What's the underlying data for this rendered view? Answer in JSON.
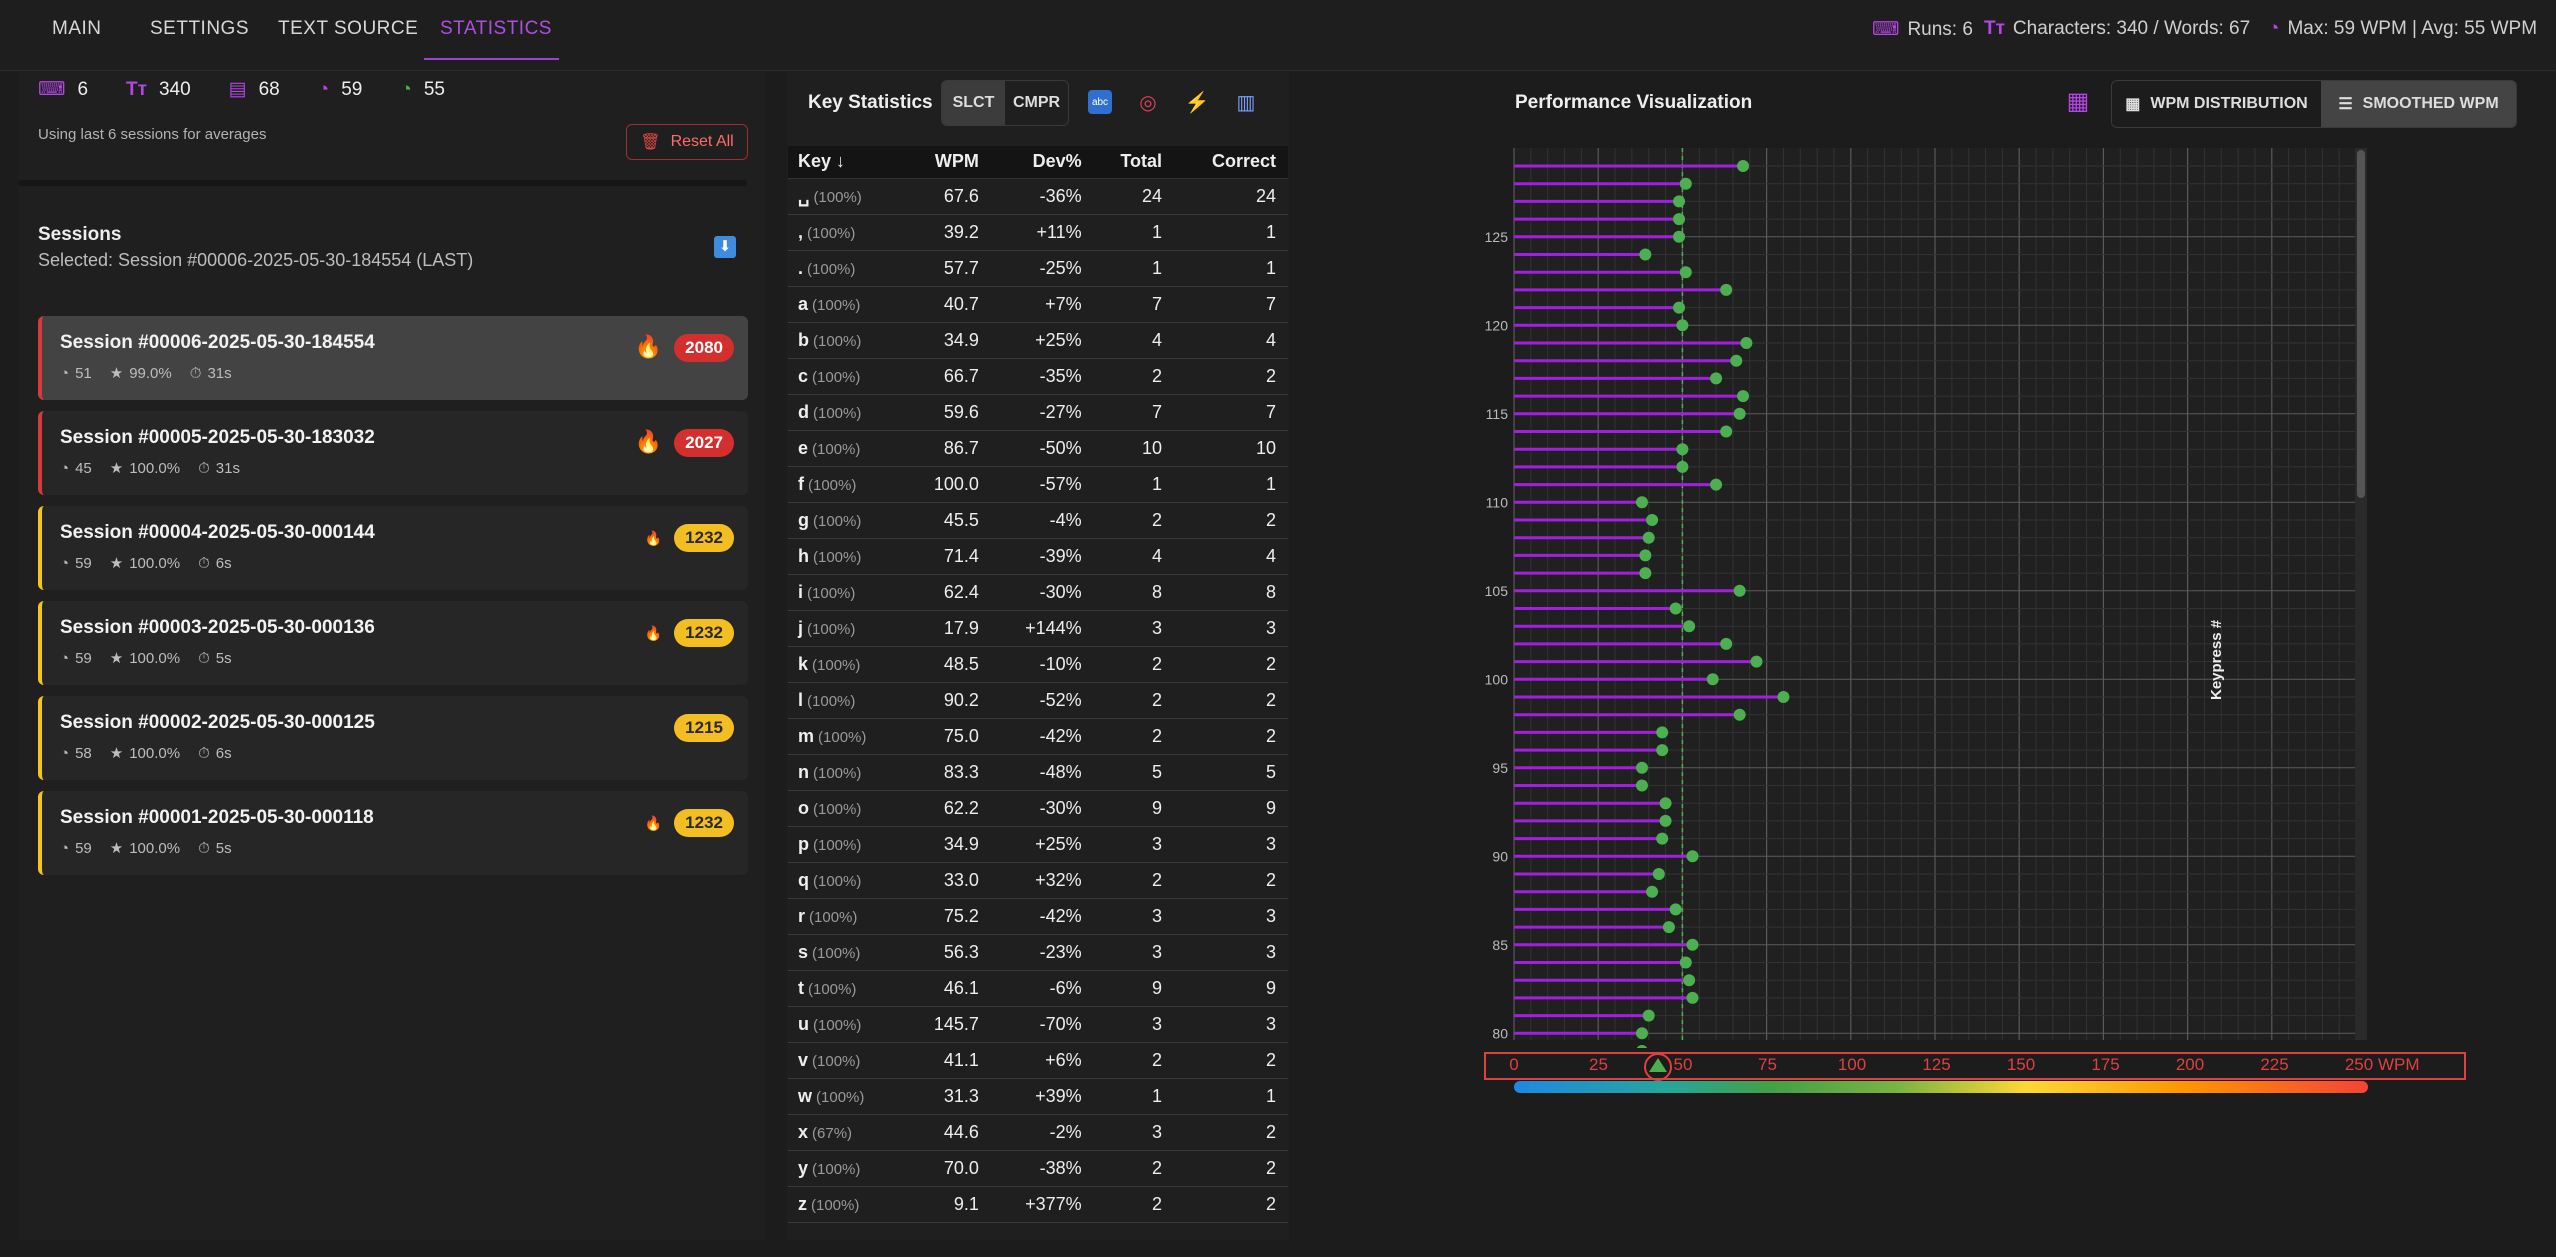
{
  "nav": {
    "tabs": [
      "MAIN",
      "SETTINGS",
      "TEXT SOURCE",
      "STATISTICS"
    ],
    "active": "STATISTICS"
  },
  "header_stats": {
    "runs": "Runs: 6",
    "chars_words": "Characters: 340 / Words: 67",
    "max_avg": "Max: 59 WPM | Avg: 55 WPM"
  },
  "summary": {
    "runs": "6",
    "characters": "340",
    "words": "68",
    "max_wpm": "59",
    "avg_wpm": "55",
    "using_note": "Using last 6 sessions for averages",
    "reset_label": "Reset All"
  },
  "sessions": {
    "title": "Sessions",
    "selected": "Selected: Session #00006-2025-05-30-184554 (LAST)",
    "items": [
      {
        "name": "Session #00006-2025-05-30-184554",
        "wpm": "51",
        "acc": "99.0%",
        "time": "31s",
        "score": "2080",
        "color": "red",
        "selected": true,
        "fire": "big"
      },
      {
        "name": "Session #00005-2025-05-30-183032",
        "wpm": "45",
        "acc": "100.0%",
        "time": "31s",
        "score": "2027",
        "color": "red",
        "selected": false,
        "fire": "big"
      },
      {
        "name": "Session #00004-2025-05-30-000144",
        "wpm": "59",
        "acc": "100.0%",
        "time": "6s",
        "score": "1232",
        "color": "yellow",
        "selected": false,
        "fire": "small"
      },
      {
        "name": "Session #00003-2025-05-30-000136",
        "wpm": "59",
        "acc": "100.0%",
        "time": "5s",
        "score": "1232",
        "color": "yellow",
        "selected": false,
        "fire": "small"
      },
      {
        "name": "Session #00002-2025-05-30-000125",
        "wpm": "58",
        "acc": "100.0%",
        "time": "6s",
        "score": "1215",
        "color": "yellow",
        "selected": false,
        "fire": "none"
      },
      {
        "name": "Session #00001-2025-05-30-000118",
        "wpm": "59",
        "acc": "100.0%",
        "time": "5s",
        "score": "1232",
        "color": "yellow",
        "selected": false,
        "fire": "small"
      }
    ]
  },
  "key_stats": {
    "title": "Key Statistics",
    "seg": [
      "SLCT",
      "CMPR"
    ],
    "headers": [
      "Key ↓",
      "WPM",
      "Dev%",
      "Total",
      "Correct"
    ],
    "rows": [
      [
        "␣",
        "(100%)",
        "67.6",
        "-36%",
        "24",
        "24"
      ],
      [
        ",",
        "(100%)",
        "39.2",
        "+11%",
        "1",
        "1"
      ],
      [
        ".",
        "(100%)",
        "57.7",
        "-25%",
        "1",
        "1"
      ],
      [
        "a",
        "(100%)",
        "40.7",
        "+7%",
        "7",
        "7"
      ],
      [
        "b",
        "(100%)",
        "34.9",
        "+25%",
        "4",
        "4"
      ],
      [
        "c",
        "(100%)",
        "66.7",
        "-35%",
        "2",
        "2"
      ],
      [
        "d",
        "(100%)",
        "59.6",
        "-27%",
        "7",
        "7"
      ],
      [
        "e",
        "(100%)",
        "86.7",
        "-50%",
        "10",
        "10"
      ],
      [
        "f",
        "(100%)",
        "100.0",
        "-57%",
        "1",
        "1"
      ],
      [
        "g",
        "(100%)",
        "45.5",
        "-4%",
        "2",
        "2"
      ],
      [
        "h",
        "(100%)",
        "71.4",
        "-39%",
        "4",
        "4"
      ],
      [
        "i",
        "(100%)",
        "62.4",
        "-30%",
        "8",
        "8"
      ],
      [
        "j",
        "(100%)",
        "17.9",
        "+144%",
        "3",
        "3"
      ],
      [
        "k",
        "(100%)",
        "48.5",
        "-10%",
        "2",
        "2"
      ],
      [
        "l",
        "(100%)",
        "90.2",
        "-52%",
        "2",
        "2"
      ],
      [
        "m",
        "(100%)",
        "75.0",
        "-42%",
        "2",
        "2"
      ],
      [
        "n",
        "(100%)",
        "83.3",
        "-48%",
        "5",
        "5"
      ],
      [
        "o",
        "(100%)",
        "62.2",
        "-30%",
        "9",
        "9"
      ],
      [
        "p",
        "(100%)",
        "34.9",
        "+25%",
        "3",
        "3"
      ],
      [
        "q",
        "(100%)",
        "33.0",
        "+32%",
        "2",
        "2"
      ],
      [
        "r",
        "(100%)",
        "75.2",
        "-42%",
        "3",
        "3"
      ],
      [
        "s",
        "(100%)",
        "56.3",
        "-23%",
        "3",
        "3"
      ],
      [
        "t",
        "(100%)",
        "46.1",
        "-6%",
        "9",
        "9"
      ],
      [
        "u",
        "(100%)",
        "145.7",
        "-70%",
        "3",
        "3"
      ],
      [
        "v",
        "(100%)",
        "41.1",
        "+6%",
        "2",
        "2"
      ],
      [
        "w",
        "(100%)",
        "31.3",
        "+39%",
        "1",
        "1"
      ],
      [
        "x",
        "(67%)",
        "44.6",
        "-2%",
        "3",
        "2"
      ],
      [
        "y",
        "(100%)",
        "70.0",
        "-38%",
        "2",
        "2"
      ],
      [
        "z",
        "(100%)",
        "9.1",
        "+377%",
        "2",
        "2"
      ]
    ]
  },
  "viz": {
    "title": "Performance Visualization",
    "buttons": [
      "WPM DISTRIBUTION",
      "SMOOTHED WPM"
    ],
    "active_button": "SMOOTHED WPM",
    "y_title": "Keypress #",
    "x_unit": "WPM",
    "x_ticks": [
      "0",
      "25",
      "50",
      "75",
      "100",
      "125",
      "150",
      "175",
      "200",
      "225",
      "250"
    ],
    "colors": {
      "bar": "#a21ee0",
      "dot": "#4caf50",
      "avg_line": "#4caf50"
    }
  },
  "chart_data": {
    "type": "bar",
    "orientation": "horizontal",
    "xlabel": "WPM",
    "ylabel": "Keypress #",
    "xlim": [
      0,
      250
    ],
    "y_ticks": [
      80,
      85,
      90,
      95,
      100,
      105,
      110,
      115,
      120,
      125
    ],
    "avg_wpm": 50,
    "grid": true,
    "keypress": [
      129,
      128,
      127,
      126,
      125,
      124,
      123,
      122,
      121,
      120,
      119,
      118,
      117,
      116,
      115,
      114,
      113,
      112,
      111,
      110,
      109,
      108,
      107,
      106,
      105,
      104,
      103,
      102,
      101,
      100,
      99,
      98,
      97,
      96,
      95,
      94,
      93,
      92,
      91,
      90,
      89,
      88,
      87,
      86,
      85,
      84,
      83,
      82,
      81,
      80,
      79
    ],
    "wpm": [
      68,
      51,
      49,
      49,
      49,
      39,
      51,
      63,
      49,
      50,
      69,
      66,
      60,
      68,
      67,
      63,
      50,
      50,
      60,
      38,
      41,
      40,
      39,
      39,
      67,
      48,
      52,
      63,
      72,
      59,
      80,
      67,
      44,
      44,
      38,
      38,
      45,
      45,
      44,
      53,
      43,
      41,
      48,
      46,
      53,
      51,
      52,
      53,
      40,
      38,
      38
    ]
  }
}
